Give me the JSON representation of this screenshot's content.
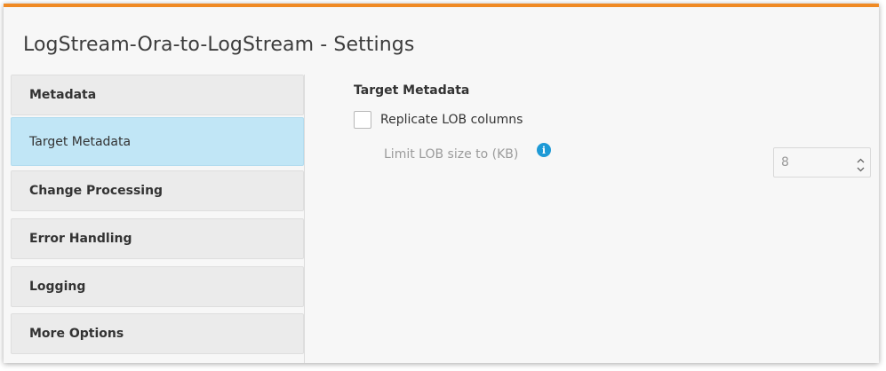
{
  "window": {
    "title": "LogStream-Ora-to-LogStream - Settings"
  },
  "sidebar": {
    "items": [
      {
        "label": "Metadata",
        "type": "header"
      },
      {
        "label": "Target Metadata",
        "type": "sub",
        "selected": true
      },
      {
        "label": "Change Processing",
        "type": "header"
      },
      {
        "label": "Error Handling",
        "type": "header"
      },
      {
        "label": "Logging",
        "type": "header"
      },
      {
        "label": "More Options",
        "type": "header"
      }
    ]
  },
  "main": {
    "section_title": "Target Metadata",
    "replicate_lob": {
      "label": "Replicate LOB columns",
      "checked": false
    },
    "limit_lob": {
      "label": "Limit LOB size to (KB)",
      "value": "8",
      "info_icon": "info-icon"
    }
  },
  "colors": {
    "accent": "#f08a24",
    "selected": "#c1e6f6",
    "info": "#1e9ad6"
  }
}
